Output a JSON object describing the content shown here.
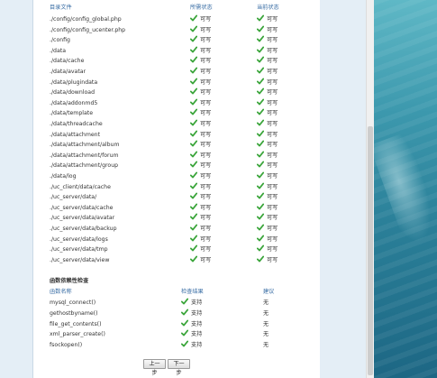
{
  "dir_check": {
    "headers": {
      "path": "目录文件",
      "required": "所需状态",
      "current": "当前状态"
    },
    "rows": [
      {
        "path": "./config/config_global.php",
        "required": "可写",
        "current": "可写"
      },
      {
        "path": "./config/config_ucenter.php",
        "required": "可写",
        "current": "可写"
      },
      {
        "path": "./config",
        "required": "可写",
        "current": "可写"
      },
      {
        "path": "./data",
        "required": "可写",
        "current": "可写"
      },
      {
        "path": "./data/cache",
        "required": "可写",
        "current": "可写"
      },
      {
        "path": "./data/avatar",
        "required": "可写",
        "current": "可写"
      },
      {
        "path": "./data/plugindata",
        "required": "可写",
        "current": "可写"
      },
      {
        "path": "./data/download",
        "required": "可写",
        "current": "可写"
      },
      {
        "path": "./data/addonmd5",
        "required": "可写",
        "current": "可写"
      },
      {
        "path": "./data/template",
        "required": "可写",
        "current": "可写"
      },
      {
        "path": "./data/threadcache",
        "required": "可写",
        "current": "可写"
      },
      {
        "path": "./data/attachment",
        "required": "可写",
        "current": "可写"
      },
      {
        "path": "./data/attachment/album",
        "required": "可写",
        "current": "可写"
      },
      {
        "path": "./data/attachment/forum",
        "required": "可写",
        "current": "可写"
      },
      {
        "path": "./data/attachment/group",
        "required": "可写",
        "current": "可写"
      },
      {
        "path": "./data/log",
        "required": "可写",
        "current": "可写"
      },
      {
        "path": "./uc_client/data/cache",
        "required": "可写",
        "current": "可写"
      },
      {
        "path": "./uc_server/data/",
        "required": "可写",
        "current": "可写"
      },
      {
        "path": "./uc_server/data/cache",
        "required": "可写",
        "current": "可写"
      },
      {
        "path": "./uc_server/data/avatar",
        "required": "可写",
        "current": "可写"
      },
      {
        "path": "./uc_server/data/backup",
        "required": "可写",
        "current": "可写"
      },
      {
        "path": "./uc_server/data/logs",
        "required": "可写",
        "current": "可写"
      },
      {
        "path": "./uc_server/data/tmp",
        "required": "可写",
        "current": "可写"
      },
      {
        "path": "./uc_server/data/view",
        "required": "可写",
        "current": "可写"
      }
    ]
  },
  "func_check": {
    "title": "函数依赖性检查",
    "headers": {
      "name": "函数名称",
      "result": "检查结果",
      "suggestion": "建议"
    },
    "rows": [
      {
        "name": "mysql_connect()",
        "result": "支持",
        "suggestion": "无"
      },
      {
        "name": "gethostbyname()",
        "result": "支持",
        "suggestion": "无"
      },
      {
        "name": "file_get_contents()",
        "result": "支持",
        "suggestion": "无"
      },
      {
        "name": "xml_parser_create()",
        "result": "支持",
        "suggestion": "无"
      },
      {
        "name": "fsockopen()",
        "result": "支持",
        "suggestion": "无"
      }
    ]
  },
  "buttons": {
    "prev": "上一步",
    "next": "下一步"
  },
  "colors": {
    "check": "#3aa53a",
    "header": "#3a6ea5"
  }
}
